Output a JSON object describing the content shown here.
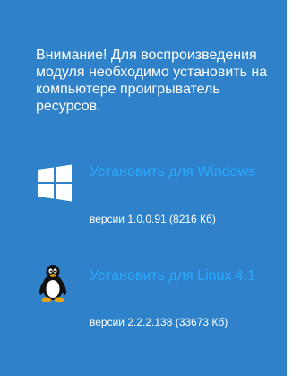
{
  "notice": {
    "text": "Внимание! Для воспроизведения модуля необходимо установить на компьютере проигрыватель ресурсов."
  },
  "installers": {
    "windows": {
      "icon": "windows-logo-icon",
      "link_label": "Установить для Windows",
      "version_label": "версии 1.0.0.91 (8216 Кб)"
    },
    "linux": {
      "icon": "linux-tux-icon",
      "link_label": "Установить для Linux 4.1",
      "version_label": "версии 2.2.2.138 (33673 Кб)"
    }
  },
  "colors": {
    "panel_background": "#2f82c9",
    "text": "#ffffff",
    "link": "#2aa7ff"
  }
}
